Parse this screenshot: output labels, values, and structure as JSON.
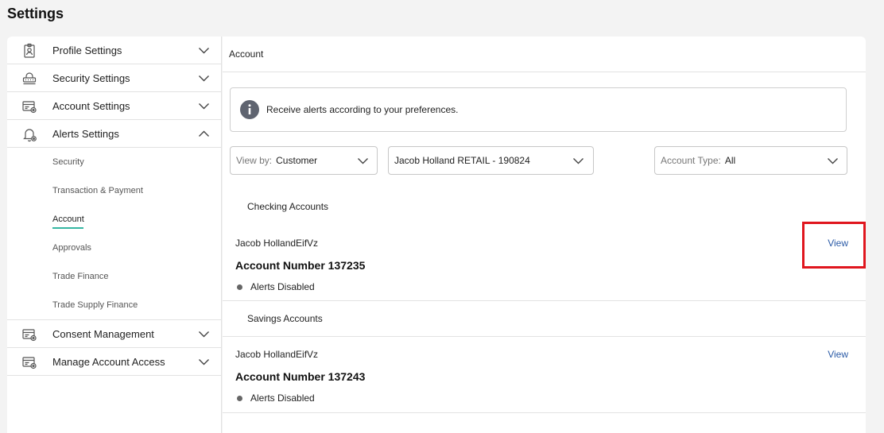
{
  "page_title": "Settings",
  "sidebar": {
    "items_top": [
      {
        "label": "Profile Settings",
        "icon": "profile-icon"
      },
      {
        "label": "Security Settings",
        "icon": "security-icon"
      },
      {
        "label": "Account Settings",
        "icon": "account-icon"
      },
      {
        "label": "Alerts Settings",
        "icon": "bell-icon",
        "expanded": true
      }
    ],
    "sub_items": [
      {
        "label": "Security"
      },
      {
        "label": "Transaction & Payment"
      },
      {
        "label": "Account",
        "active": true
      },
      {
        "label": "Approvals"
      },
      {
        "label": "Trade Finance"
      },
      {
        "label": "Trade Supply Finance"
      }
    ],
    "items_bottom": [
      {
        "label": "Consent Management",
        "icon": "consent-icon"
      },
      {
        "label": "Manage Account Access",
        "icon": "access-icon"
      }
    ]
  },
  "main": {
    "header": "Account",
    "info_text": "Receive alerts according to your preferences.",
    "filters": {
      "view_by_prefix": "View by:",
      "view_by_value": "Customer",
      "customer_value": "Jacob Holland RETAIL - 190824",
      "account_type_prefix": "Account Type:",
      "account_type_value": "All"
    },
    "sections": [
      {
        "label": "Checking Accounts",
        "accounts": [
          {
            "name": "Jacob HollandEifVz",
            "number": "Account Number 137235",
            "status": "Alerts Disabled",
            "link": "View"
          }
        ]
      },
      {
        "label": "Savings Accounts",
        "accounts": [
          {
            "name": "Jacob HollandEifVz",
            "number": "Account Number 137243",
            "status": "Alerts Disabled",
            "link": "View"
          }
        ]
      }
    ]
  },
  "colors": {
    "accent": "#35b6a2",
    "link": "#2a5aa6",
    "highlight": "#e0161e"
  }
}
